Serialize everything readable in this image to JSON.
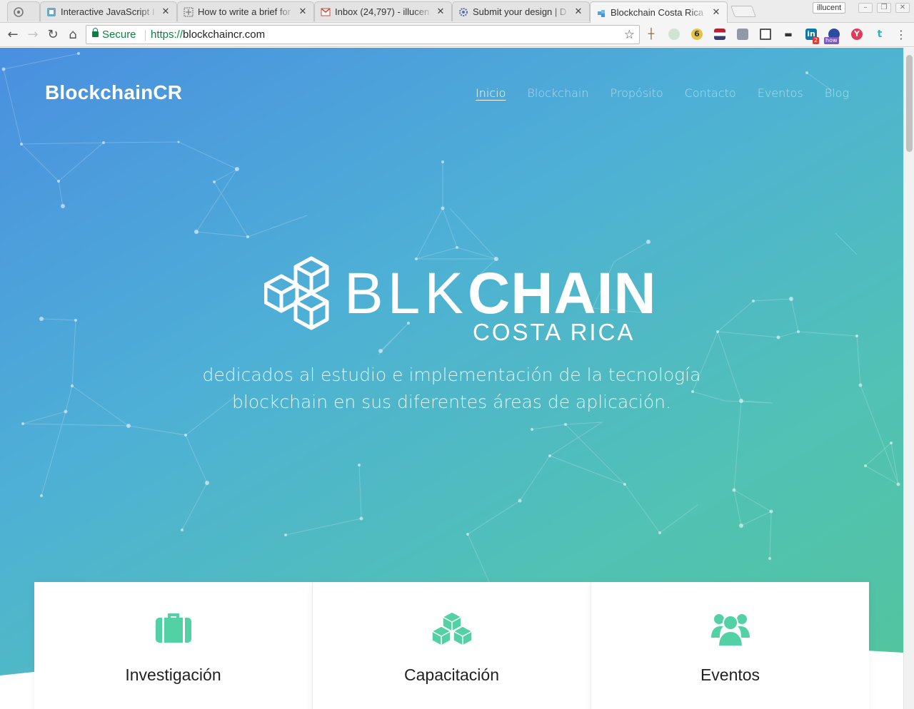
{
  "browser": {
    "tabs": [
      {
        "title": "",
        "favicon": "github-icon"
      },
      {
        "title": "Interactive JavaScript I",
        "favicon": "app-icon"
      },
      {
        "title": "How to write a brief for",
        "favicon": "mesh-icon"
      },
      {
        "title": "Inbox (24,797) - illucen",
        "favicon": "gmail-icon"
      },
      {
        "title": "Submit your design | D",
        "favicon": "gear-icon"
      },
      {
        "title": "Blockchain Costa Rica",
        "favicon": "blocks-icon"
      }
    ],
    "profile_name": "illucent",
    "address": {
      "secure_label": "Secure",
      "scheme": "https://",
      "host": "blockchaincr.com"
    },
    "extension_badges": {
      "linkedin": "2",
      "how": "how"
    }
  },
  "page": {
    "brand": "BlockchainCR",
    "nav": [
      {
        "label": "Inicio",
        "active": true
      },
      {
        "label": "Blockchain",
        "active": false
      },
      {
        "label": "Propósito",
        "active": false
      },
      {
        "label": "Contacto",
        "active": false
      },
      {
        "label": "Eventos",
        "active": false
      },
      {
        "label": "Blog",
        "active": false
      }
    ],
    "logo": {
      "word_thin": "BLK",
      "word_bold": "CHAIN",
      "subtitle": "COSTA RICA"
    },
    "tagline_line1": "dedicados al estudio e implementación de la tecnología",
    "tagline_line2": "blockchain en sus diferentes áreas de aplicación.",
    "cards": [
      {
        "title": "Investigación",
        "icon": "briefcase-icon"
      },
      {
        "title": "Capacitación",
        "icon": "cubes-icon"
      },
      {
        "title": "Eventos",
        "icon": "users-icon"
      }
    ],
    "colors": {
      "gradient_start": "#4a8fe0",
      "gradient_end": "#52c49b",
      "accent": "#52d1a4"
    }
  }
}
